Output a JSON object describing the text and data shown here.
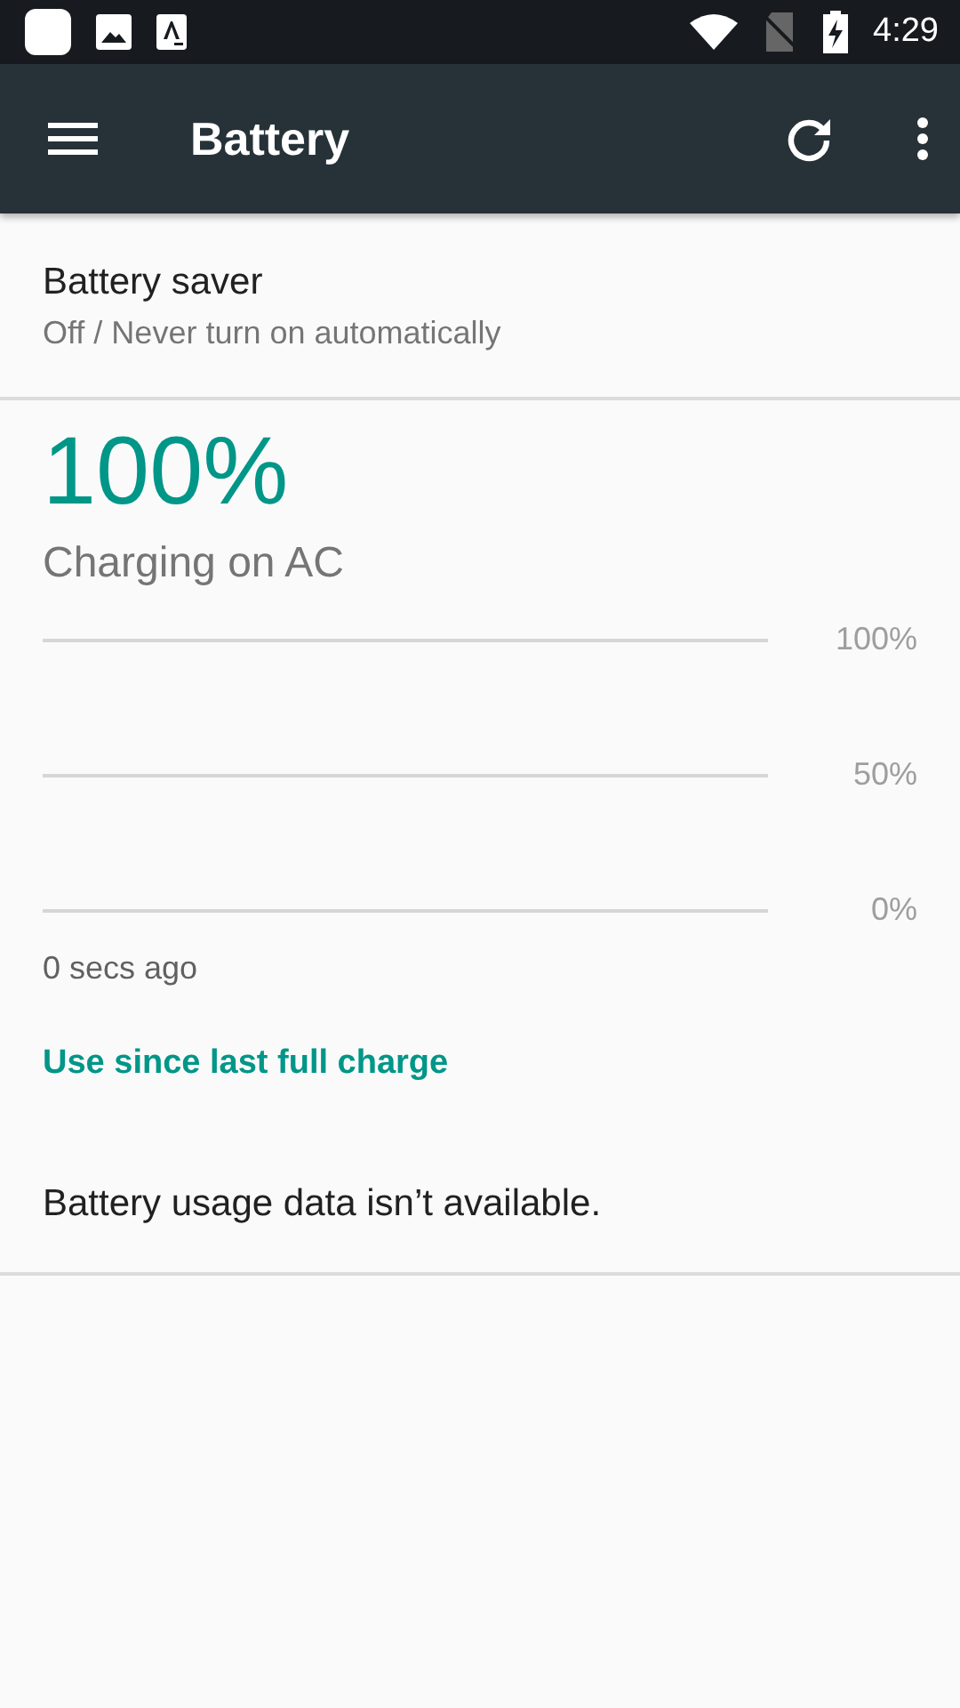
{
  "status_bar": {
    "time": "4:29"
  },
  "app_bar": {
    "title": "Battery"
  },
  "battery_saver": {
    "title": "Battery saver",
    "summary": "Off / Never turn on automatically"
  },
  "battery": {
    "level_text": "100%",
    "status": "Charging on AC"
  },
  "history_chart": {
    "yticks": [
      "100%",
      "50%",
      "0%"
    ],
    "time_label": "0 secs ago"
  },
  "usage": {
    "heading": "Use since last full charge",
    "message": "Battery usage data isn’t available."
  }
}
